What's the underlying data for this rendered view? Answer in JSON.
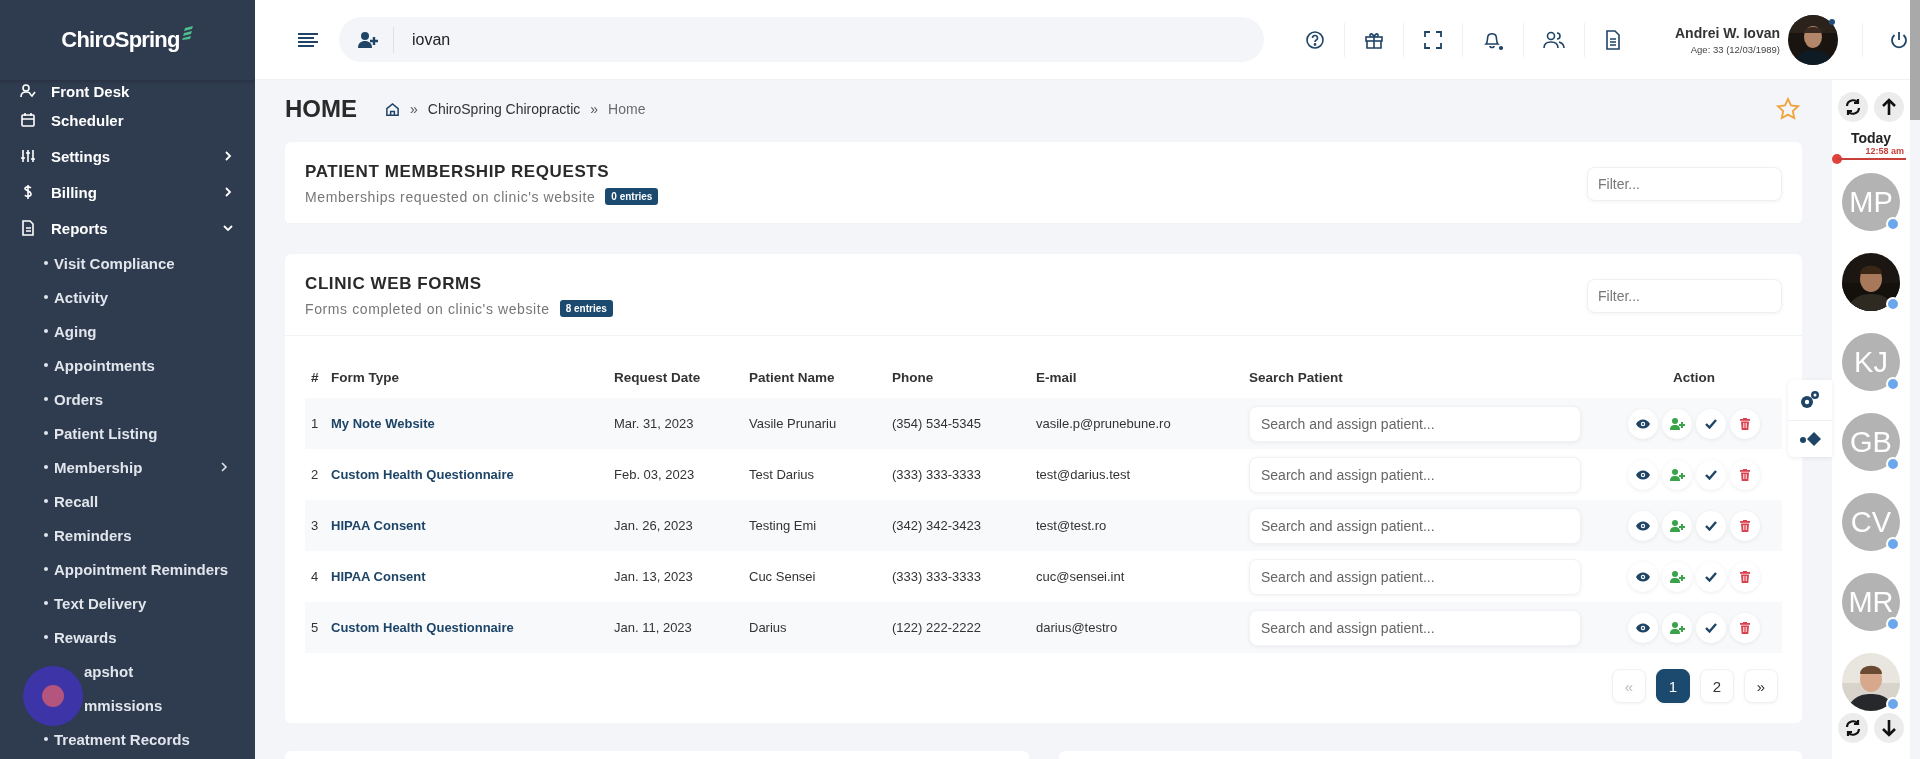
{
  "sidebar": {
    "logo": "ChiroSpring",
    "items": [
      {
        "kind": "top",
        "label": "Front Desk",
        "has_arrow": false
      },
      {
        "kind": "top",
        "label": "Scheduler",
        "has_arrow": false
      },
      {
        "kind": "top",
        "label": "Settings",
        "has_arrow": true,
        "expanded": false
      },
      {
        "kind": "top",
        "label": "Billing",
        "has_arrow": true,
        "expanded": false
      },
      {
        "kind": "top",
        "label": "Reports",
        "has_arrow": true,
        "expanded": true
      },
      {
        "kind": "sub",
        "label": "Visit Compliance",
        "has_arrow": false
      },
      {
        "kind": "sub",
        "label": "Activity",
        "has_arrow": false
      },
      {
        "kind": "sub",
        "label": "Aging",
        "has_arrow": false
      },
      {
        "kind": "sub",
        "label": "Appointments",
        "has_arrow": false
      },
      {
        "kind": "sub",
        "label": "Orders",
        "has_arrow": false
      },
      {
        "kind": "sub",
        "label": "Patient Listing",
        "has_arrow": false
      },
      {
        "kind": "sub",
        "label": "Membership",
        "has_arrow": true
      },
      {
        "kind": "sub",
        "label": "Recall",
        "has_arrow": false
      },
      {
        "kind": "sub",
        "label": "Reminders",
        "has_arrow": false
      },
      {
        "kind": "sub",
        "label": "Appointment Reminders",
        "has_arrow": false
      },
      {
        "kind": "sub",
        "label": "Text Delivery",
        "has_arrow": false
      },
      {
        "kind": "sub",
        "label": "Rewards",
        "has_arrow": false
      },
      {
        "kind": "covered",
        "label": "apshot"
      },
      {
        "kind": "covered",
        "label": "mmissions"
      },
      {
        "kind": "sub",
        "label": "Treatment Records",
        "has_arrow": false
      }
    ]
  },
  "header": {
    "search_value": "iovan",
    "user_name": "Andrei W. Iovan",
    "user_age": "Age: 33 (12/03/1989)"
  },
  "page": {
    "title": "HOME",
    "breadcrumb": [
      {
        "sep": "»",
        "label": "ChiroSpring Chiropractic"
      },
      {
        "sep": "»",
        "label": "Home"
      }
    ]
  },
  "cards": [
    {
      "title": "PATIENT MEMBERSHIP REQUESTS",
      "subtitle": "Memberships requested on clinic's website",
      "badge": "0 entries",
      "filter_placeholder": "Filter..."
    },
    {
      "title": "CLINIC WEB FORMS",
      "subtitle": "Forms completed on clinic's website",
      "badge": "8 entries",
      "filter_placeholder": "Filter..."
    }
  ],
  "table": {
    "columns": [
      "#",
      "Form Type",
      "Request Date",
      "Patient Name",
      "Phone",
      "E-mail",
      "Search Patient",
      "Action"
    ],
    "rows": [
      {
        "num": "1",
        "form_type": "My Note Website",
        "date": "Mar. 31, 2023",
        "patient": "Vasile Prunariu",
        "phone": "(354) 534-5345",
        "email": "vasile.p@prunebune.ro",
        "search_placeholder": "Search and assign patient..."
      },
      {
        "num": "2",
        "form_type": "Custom Health Questionnaire",
        "date": "Feb. 03, 2023",
        "patient": "Test Darius",
        "phone": "(333) 333-3333",
        "email": "test@darius.test",
        "search_placeholder": "Search and assign patient..."
      },
      {
        "num": "3",
        "form_type": "HIPAA Consent",
        "date": "Jan. 26, 2023",
        "patient": "Testing Emi",
        "phone": "(342) 342-3423",
        "email": "test@test.ro",
        "search_placeholder": "Search and assign patient..."
      },
      {
        "num": "4",
        "form_type": "HIPAA Consent",
        "date": "Jan. 13, 2023",
        "patient": "Cuc Sensei",
        "phone": "(333) 333-3333",
        "email": "cuc@sensei.int",
        "search_placeholder": "Search and assign patient..."
      },
      {
        "num": "5",
        "form_type": "Custom Health Questionnaire",
        "date": "Jan. 11, 2023",
        "patient": "Darius",
        "phone": "(122) 222-2222",
        "email": "darius@testro",
        "search_placeholder": "Search and assign patient..."
      }
    ]
  },
  "pagination": [
    {
      "label": "«",
      "selected": false,
      "disabled": true
    },
    {
      "label": "1",
      "selected": true,
      "disabled": false
    },
    {
      "label": "2",
      "selected": false,
      "disabled": false
    },
    {
      "label": "»",
      "selected": false,
      "disabled": false
    }
  ],
  "schedule": {
    "day": "Today",
    "time": "12:58 am",
    "avatars": [
      {
        "kind": "initials",
        "label": "MP"
      },
      {
        "kind": "picture"
      },
      {
        "kind": "initials",
        "label": "KJ"
      },
      {
        "kind": "initials",
        "label": "GB"
      },
      {
        "kind": "initials",
        "label": "CV"
      },
      {
        "kind": "initials",
        "label": "MR"
      },
      {
        "kind": "picture"
      }
    ]
  }
}
